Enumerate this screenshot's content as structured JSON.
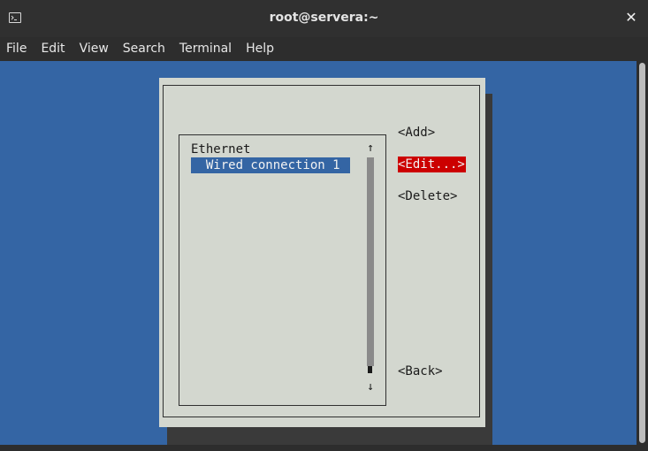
{
  "window": {
    "title": "root@servera:~",
    "close_label": "✕"
  },
  "menubar": {
    "items": [
      {
        "label": "File"
      },
      {
        "label": "Edit"
      },
      {
        "label": "View"
      },
      {
        "label": "Search"
      },
      {
        "label": "Terminal"
      },
      {
        "label": "Help"
      }
    ]
  },
  "dialog": {
    "list": {
      "group_header": "Ethernet",
      "items": [
        {
          "label": "  Wired connection 1",
          "selected": true
        }
      ],
      "arrow_up": "↑",
      "arrow_down": "↓"
    },
    "buttons": {
      "add": "<Add>",
      "edit": "<Edit...>",
      "delete": "<Delete>",
      "back": "<Back>"
    }
  },
  "colors": {
    "terminal_bg": "#3465a4",
    "dialog_bg": "#d3d7cf",
    "selected_bg": "#3465a4",
    "focused_button_bg": "#cc0000"
  }
}
